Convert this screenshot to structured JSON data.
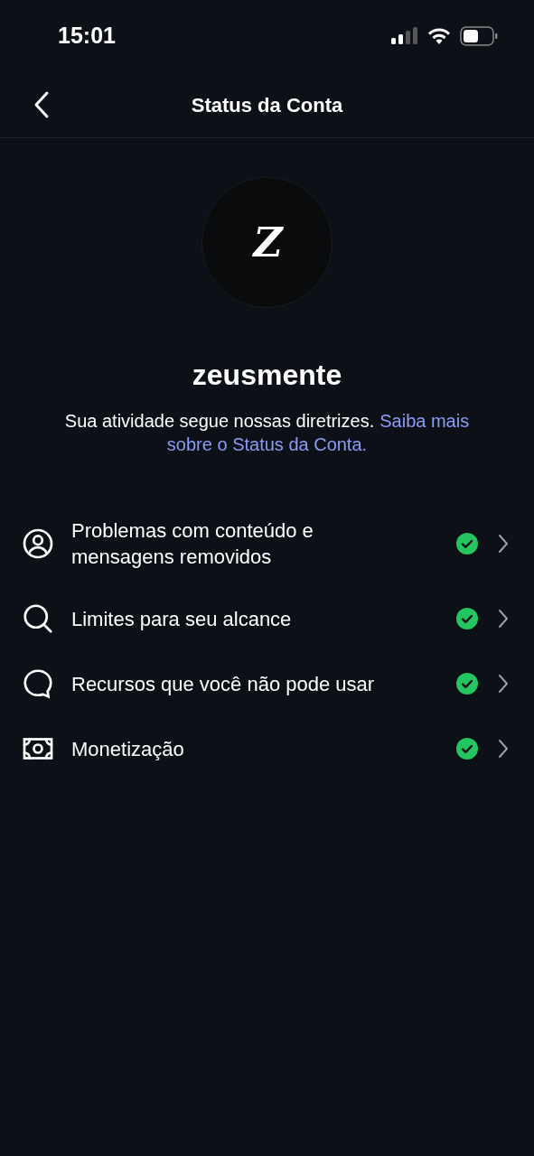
{
  "status_bar": {
    "time": "15:01"
  },
  "header": {
    "title": "Status da Conta"
  },
  "profile": {
    "logo_text": "Z",
    "username": "zeusmente",
    "description": "Sua atividade segue nossas diretrizes.",
    "link_lines": [
      "Saiba mais",
      "sobre o Status da Conta."
    ]
  },
  "items": [
    {
      "kind": "person",
      "label": "Problemas com conteúdo e mensagens removidos",
      "ok": true
    },
    {
      "kind": "search",
      "label": "Limites para seu alcance",
      "ok": true
    },
    {
      "kind": "chat",
      "label": "Recursos que você não pode usar",
      "ok": true
    },
    {
      "kind": "money",
      "label": "Monetização",
      "ok": true
    }
  ]
}
